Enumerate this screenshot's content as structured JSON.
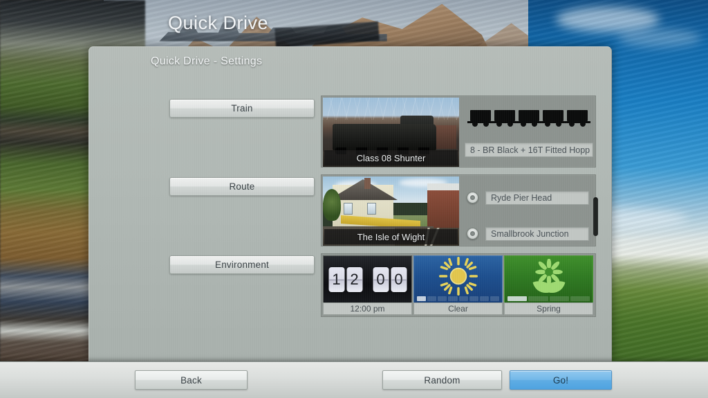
{
  "page": {
    "title": "Quick Drive"
  },
  "dialog": {
    "title": "Quick Drive - Settings",
    "categories": [
      {
        "label": "Train"
      },
      {
        "label": "Route"
      },
      {
        "label": "Environment"
      }
    ]
  },
  "train": {
    "loco_name": "Class 08 Shunter",
    "consist_value": "8 - BR Black + 16T Fitted Hopp",
    "consist_wagon_count": 5,
    "loco_thumb_icon": "locomotive-photo",
    "consist_icon": "wagon-silhouettes"
  },
  "route": {
    "route_name": "The Isle of Wight",
    "route_thumb_icon": "station-photo",
    "start_station": "Ryde Pier Head",
    "end_station": "Smallbrook Junction"
  },
  "environment": {
    "time": {
      "digits": [
        "1",
        "2",
        "0",
        "0"
      ],
      "label": "12:00 pm",
      "icon": "flip-clock"
    },
    "weather": {
      "label": "Clear",
      "icon": "sun-icon",
      "slider_segments": 8,
      "slider_active_index": 0
    },
    "season": {
      "label": "Spring",
      "icon": "flower-icon",
      "slider_segments": 4,
      "slider_active_index": 0
    }
  },
  "footer": {
    "back_label": "Back",
    "random_label": "Random",
    "go_label": "Go!"
  },
  "colors": {
    "dialog_bg": "#b1b9b5",
    "panel_bg": "#8d9490",
    "go_accent": "#5fade4",
    "field_bg": "#c2c7c4",
    "weather_tile": "#1d4f8e",
    "season_tile": "#2f7a22"
  }
}
